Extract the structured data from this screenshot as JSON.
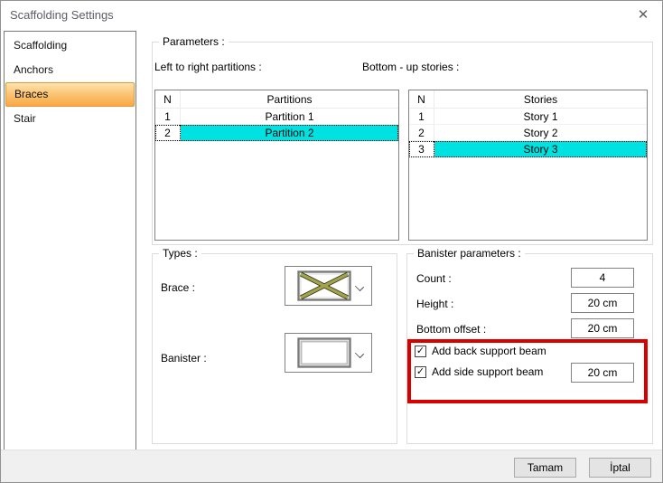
{
  "window": {
    "title": "Scaffolding Settings",
    "close_glyph": "✕"
  },
  "sidebar": {
    "items": [
      {
        "label": "Scaffolding",
        "selected": false
      },
      {
        "label": "Anchors",
        "selected": false
      },
      {
        "label": "Braces",
        "selected": true
      },
      {
        "label": "Stair",
        "selected": false
      }
    ]
  },
  "parameters": {
    "group_label": "Parameters :",
    "partitions": {
      "label": "Left to right partitions :",
      "columns": [
        "N",
        "Partitions"
      ],
      "rows": [
        {
          "n": "1",
          "name": "Partition 1",
          "selected": false
        },
        {
          "n": "2",
          "name": "Partition 2",
          "selected": true
        }
      ]
    },
    "stories": {
      "label": "Bottom - up stories :",
      "columns": [
        "N",
        "Stories"
      ],
      "rows": [
        {
          "n": "1",
          "name": "Story 1",
          "selected": false
        },
        {
          "n": "2",
          "name": "Story 2",
          "selected": false
        },
        {
          "n": "3",
          "name": "Story 3",
          "selected": true
        }
      ]
    }
  },
  "types": {
    "group_label": "Types :",
    "brace_label": "Brace :",
    "brace_icon": "cross-brace-icon",
    "banister_label": "Banister :",
    "banister_icon": "rectangle-frame-icon"
  },
  "banister_params": {
    "group_label": "Banister parameters :",
    "count_label": "Count :",
    "count_value": "4",
    "height_label": "Height :",
    "height_value": "20 cm",
    "bottom_offset_label": "Bottom offset :",
    "bottom_offset_value": "20 cm",
    "check_glyph": "✓",
    "add_back_label": "Add back support beam",
    "add_back_checked": true,
    "add_side_label": "Add side support beam",
    "add_side_checked": true,
    "add_side_value": "20 cm"
  },
  "footer": {
    "ok_label": "Tamam",
    "cancel_label": "İptal"
  },
  "colors": {
    "selection_cyan": "#00e1e1",
    "annotation_red": "#d90000",
    "accent_orange": "#f9a843"
  }
}
